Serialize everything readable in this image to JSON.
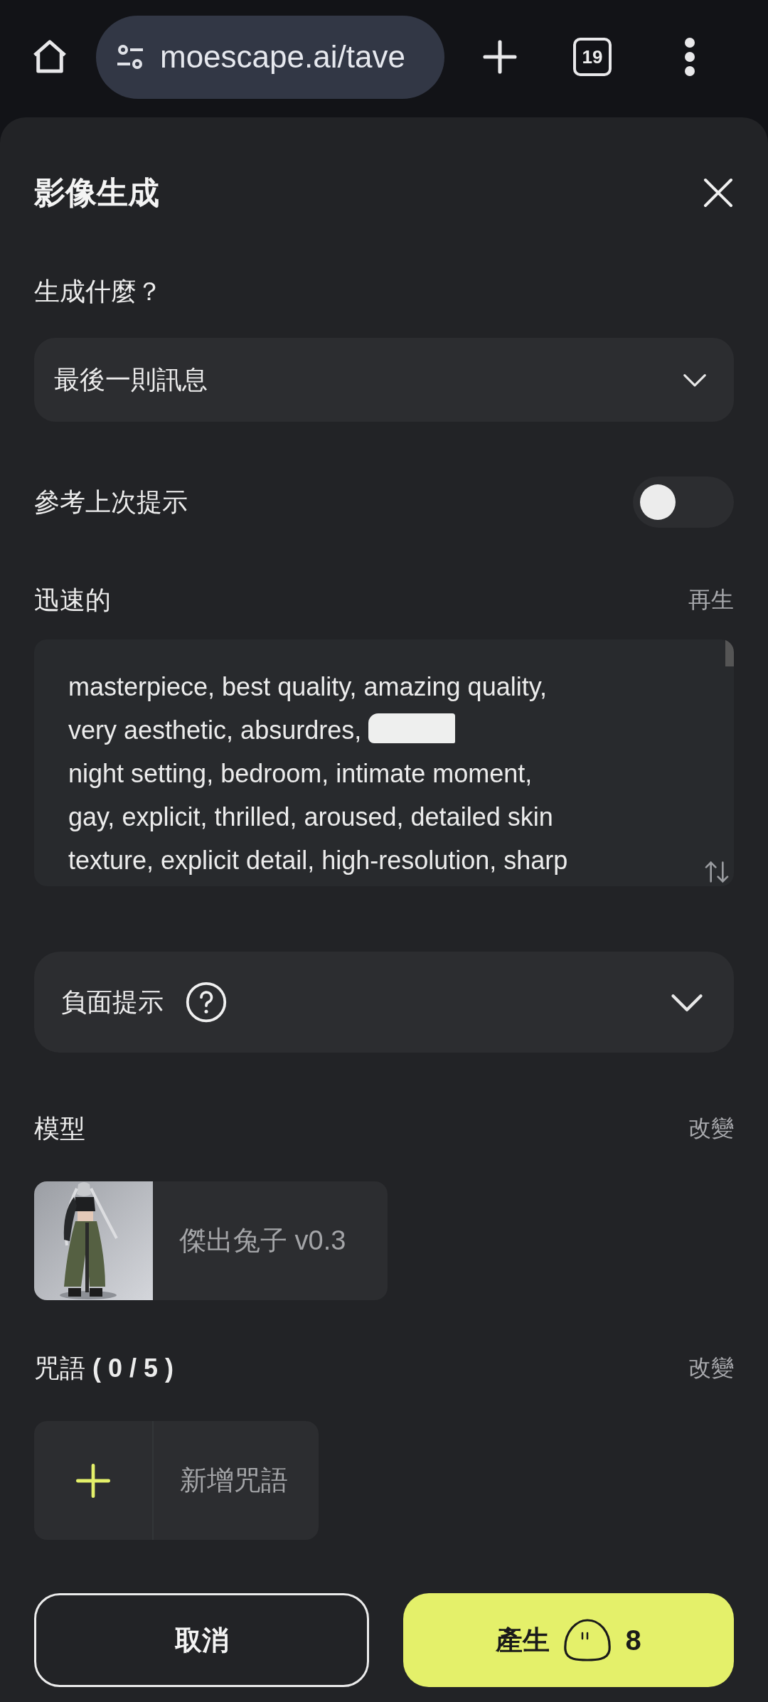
{
  "browser": {
    "url": "moescape.ai/tave",
    "tab_count": "19"
  },
  "sheet": {
    "title": "影像生成"
  },
  "target": {
    "label": "生成什麼？",
    "value": "最後一則訊息"
  },
  "reference": {
    "label": "參考上次提示",
    "on": false
  },
  "prompt": {
    "label": "迅速的",
    "action": "再生",
    "lines": [
      "masterpiece, best quality, amazing quality,",
      "very aesthetic, absurdres,",
      "night setting, bedroom, intimate moment,",
      "gay, explicit, thrilled, aroused, detailed skin",
      "texture, explicit detail, high-resolution, sharp"
    ],
    "redacted": true
  },
  "negative": {
    "label": "負面提示",
    "expanded": false
  },
  "model": {
    "label": "模型",
    "action": "改變",
    "name": "傑出兔子 v0.3",
    "kind": "picture"
  },
  "spells": {
    "label": "咒語 **( 0 / 5 )**",
    "action": "改變",
    "add": "新增咒語"
  },
  "buttons": [
    {
      "kind": "secondary",
      "label": "取消"
    },
    {
      "kind": "primary",
      "label": "產生",
      "cost": "8"
    }
  ]
}
